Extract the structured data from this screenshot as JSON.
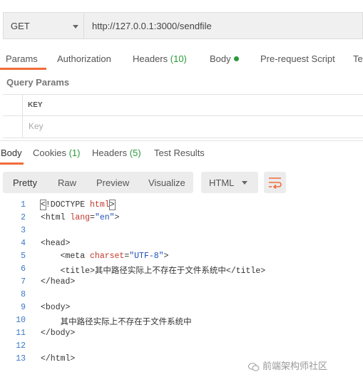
{
  "request": {
    "method": "GET",
    "url": "http://127.0.0.1:3000/sendfile"
  },
  "request_tabs": [
    {
      "label": "Params",
      "count": "",
      "dot": false
    },
    {
      "label": "Authorization",
      "count": "",
      "dot": false
    },
    {
      "label": "Headers",
      "count": "(10)",
      "dot": false
    },
    {
      "label": "Body",
      "count": "",
      "dot": true
    },
    {
      "label": "Pre-request Script",
      "count": "",
      "dot": false
    },
    {
      "label": "Te",
      "count": "",
      "dot": false
    }
  ],
  "query_params": {
    "title": "Query Params",
    "key_header": "KEY",
    "key_placeholder": "Key"
  },
  "response_tabs": [
    {
      "label": "Body",
      "count": ""
    },
    {
      "label": "Cookies",
      "count": "(1)"
    },
    {
      "label": "Headers",
      "count": "(5)"
    },
    {
      "label": "Test Results",
      "count": ""
    }
  ],
  "view_modes": [
    "Pretty",
    "Raw",
    "Preview",
    "Visualize"
  ],
  "format": "HTML",
  "code_lines": [
    {
      "n": "1",
      "parts": [
        {
          "t": "<",
          "c": "tag",
          "box": true
        },
        {
          "t": "!DOCTYPE ",
          "c": "tag"
        },
        {
          "t": "html",
          "c": "attr"
        },
        {
          "t": ">",
          "c": "tag",
          "box": true
        }
      ]
    },
    {
      "n": "2",
      "parts": [
        {
          "t": "<html ",
          "c": "tag"
        },
        {
          "t": "lang",
          "c": "attr"
        },
        {
          "t": "=",
          "c": "tag"
        },
        {
          "t": "\"en\"",
          "c": "str"
        },
        {
          "t": ">",
          "c": "tag"
        }
      ]
    },
    {
      "n": "3",
      "parts": []
    },
    {
      "n": "4",
      "parts": [
        {
          "t": "<head>",
          "c": "tag"
        }
      ]
    },
    {
      "n": "5",
      "parts": [
        {
          "t": "    <meta ",
          "c": "tag"
        },
        {
          "t": "charset",
          "c": "attr"
        },
        {
          "t": "=",
          "c": "tag"
        },
        {
          "t": "\"UTF-8\"",
          "c": "str"
        },
        {
          "t": ">",
          "c": "tag"
        }
      ]
    },
    {
      "n": "6",
      "parts": [
        {
          "t": "    <title>",
          "c": "tag"
        },
        {
          "t": "其中路径实际上不存在于文件系统中",
          "c": "tag"
        },
        {
          "t": "</title>",
          "c": "tag"
        }
      ]
    },
    {
      "n": "7",
      "parts": [
        {
          "t": "</head>",
          "c": "tag"
        }
      ]
    },
    {
      "n": "8",
      "parts": []
    },
    {
      "n": "9",
      "parts": [
        {
          "t": "<body>",
          "c": "tag"
        }
      ]
    },
    {
      "n": "10",
      "parts": [
        {
          "t": "    其中路径实际上不存在于文件系统中",
          "c": "tag"
        }
      ]
    },
    {
      "n": "11",
      "parts": [
        {
          "t": "</body>",
          "c": "tag"
        }
      ]
    },
    {
      "n": "12",
      "parts": []
    },
    {
      "n": "13",
      "parts": [
        {
          "t": "</html>",
          "c": "tag"
        }
      ]
    }
  ],
  "watermark": "前端架构师社区",
  "colors": {
    "accent": "#f26b3a",
    "count_green": "#2a9a3a",
    "line_number": "#3a78c2",
    "attribute": "#c0392b",
    "string": "#1f4fb5"
  },
  "icons": {
    "method_dropdown": "chevron-down-icon",
    "format_dropdown": "chevron-down-icon",
    "wrap": "text-wrap-icon",
    "body_status": "dot-icon",
    "watermark": "wechat-logo-icon"
  }
}
